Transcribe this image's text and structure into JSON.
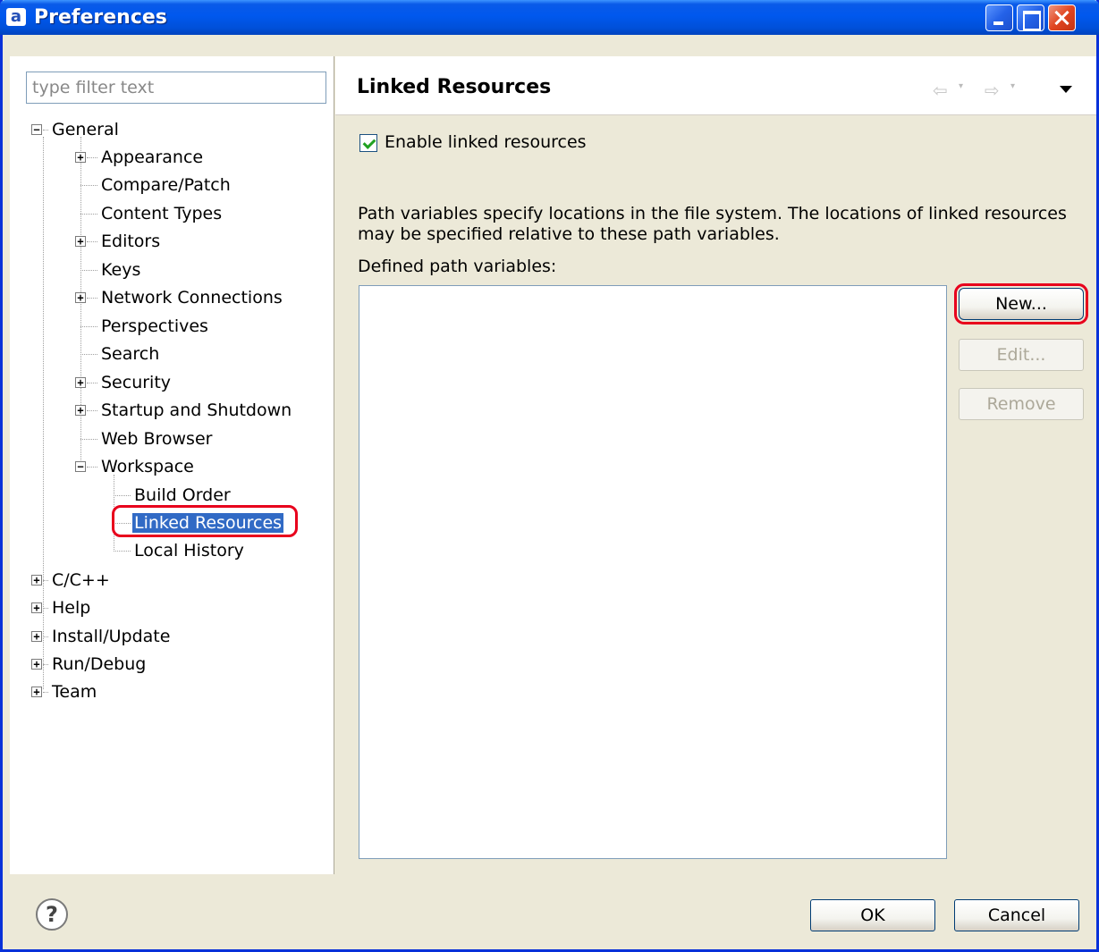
{
  "window": {
    "title": "Preferences",
    "app_icon_glyph": "a"
  },
  "filter": {
    "placeholder": "type filter text",
    "value": ""
  },
  "tree": [
    {
      "label": "General",
      "expander": "−"
    },
    {
      "label": "Appearance",
      "expander": "+"
    },
    {
      "label": "Compare/Patch"
    },
    {
      "label": "Content Types"
    },
    {
      "label": "Editors",
      "expander": "+"
    },
    {
      "label": "Keys"
    },
    {
      "label": "Network Connections",
      "expander": "+"
    },
    {
      "label": "Perspectives"
    },
    {
      "label": "Search"
    },
    {
      "label": "Security",
      "expander": "+"
    },
    {
      "label": "Startup and Shutdown",
      "expander": "+"
    },
    {
      "label": "Web Browser"
    },
    {
      "label": "Workspace",
      "expander": "−"
    },
    {
      "label": "Build Order"
    },
    {
      "label": "Linked Resources",
      "selected": true
    },
    {
      "label": "Local History"
    },
    {
      "label": "C/C++",
      "expander": "+"
    },
    {
      "label": "Help",
      "expander": "+"
    },
    {
      "label": "Install/Update",
      "expander": "+"
    },
    {
      "label": "Run/Debug",
      "expander": "+"
    },
    {
      "label": "Team",
      "expander": "+"
    }
  ],
  "page": {
    "title": "Linked Resources",
    "enable_checkbox_label": "Enable linked resources",
    "enable_checked": true,
    "description_line1": "Path variables specify locations in the file system. The locations of linked resources",
    "description_line2": "may be specified relative to these path variables.",
    "defined_label": "Defined path variables:",
    "path_variables": []
  },
  "buttons": {
    "new": "New...",
    "edit": "Edit...",
    "remove": "Remove",
    "ok": "OK",
    "cancel": "Cancel"
  },
  "nav": {
    "back": "⇦",
    "forward": "⇨",
    "dropdown": "▾"
  },
  "colors": {
    "selection": "#316ac5",
    "highlight_ring": "#e8001c",
    "titlebar": "#0058ee"
  }
}
